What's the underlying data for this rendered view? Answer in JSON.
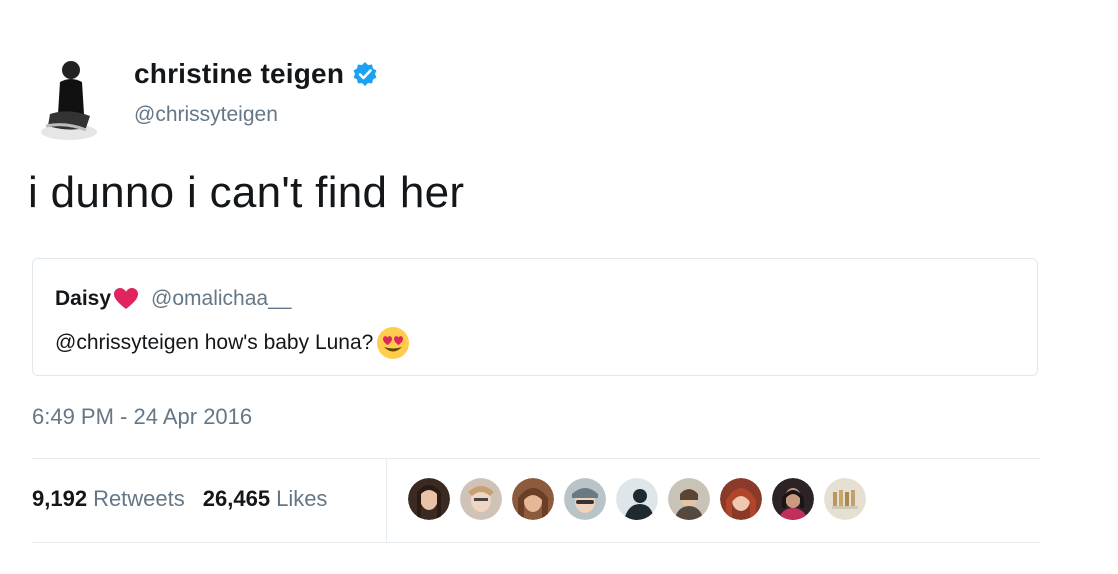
{
  "tweet": {
    "author_name": "christine teigen",
    "author_handle": "@chrissyteigen",
    "verified": true,
    "text": "i dunno i can't find her",
    "timestamp": "6:49 PM - 24 Apr 2016"
  },
  "quote": {
    "author_name": "Daisy",
    "author_handle": "@omalichaa__",
    "text": "@chrissyteigen how's baby Luna?",
    "name_emoji": "red-heart-icon",
    "text_emoji": "heart-eyes-emoji-icon"
  },
  "stats": {
    "retweets_count": "9,192",
    "retweets_label": "Retweets",
    "likes_count": "26,465",
    "likes_label": "Likes"
  },
  "colors": {
    "verified_blue": "#1da1f2",
    "secondary_text": "#657786",
    "heart_red": "#e0245e"
  },
  "likers": [
    "liker-avatar",
    "liker-avatar",
    "liker-avatar",
    "liker-avatar",
    "liker-avatar",
    "liker-avatar",
    "liker-avatar",
    "liker-avatar",
    "liker-avatar"
  ]
}
